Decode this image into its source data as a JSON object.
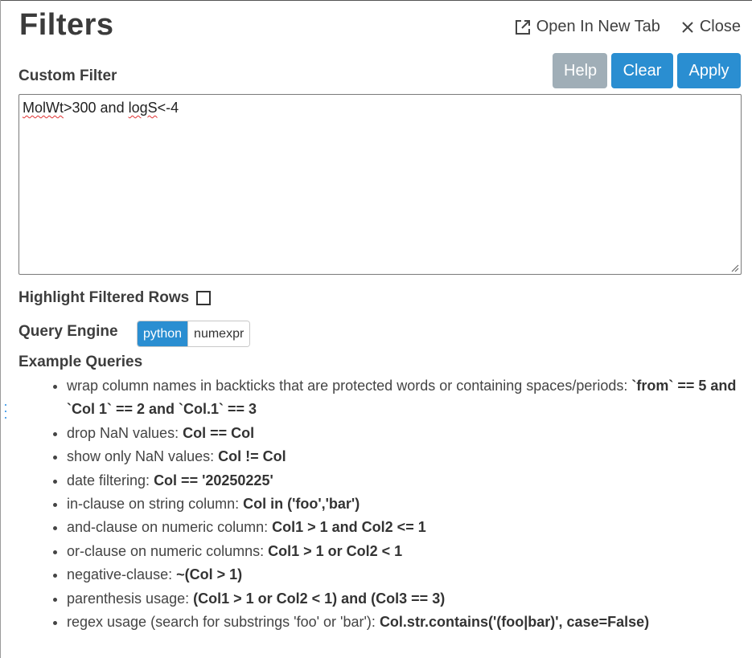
{
  "header": {
    "title": "Filters",
    "open_new_tab_label": "Open In New Tab",
    "close_label": "Close"
  },
  "custom_filter": {
    "label": "Custom Filter",
    "help_label": "Help",
    "clear_label": "Clear",
    "apply_label": "Apply",
    "query_part1": "MolWt",
    "query_part2": ">300 and ",
    "query_part3": "logS",
    "query_part4": "<-4"
  },
  "highlight": {
    "label": "Highlight Filtered Rows",
    "checked": false
  },
  "query_engine": {
    "label": "Query Engine",
    "options": [
      "python",
      "numexpr"
    ],
    "selected": "python"
  },
  "examples": {
    "title": "Example Queries",
    "items": [
      {
        "text": "wrap column names in backticks that are protected words or containing spaces/periods: ",
        "code": "`from` == 5 and `Col 1` == 2 and `Col.1` == 3"
      },
      {
        "text": "drop NaN values: ",
        "code": "Col == Col"
      },
      {
        "text": "show only NaN values: ",
        "code": "Col != Col"
      },
      {
        "text": "date filtering: ",
        "code": "Col == '20250225'"
      },
      {
        "text": "in-clause on string column: ",
        "code": "Col in ('foo','bar')"
      },
      {
        "text": "and-clause on numeric column: ",
        "code": "Col1 > 1 and Col2 <= 1"
      },
      {
        "text": "or-clause on numeric columns: ",
        "code": "Col1 > 1 or Col2 < 1"
      },
      {
        "text": "negative-clause: ",
        "code": "~(Col > 1)"
      },
      {
        "text": "parenthesis usage: ",
        "code": "(Col1 > 1 or Col2 < 1) and (Col3 == 3)"
      },
      {
        "text": "regex usage (search for substrings 'foo' or 'bar'): ",
        "code": "Col.str.contains('(foo|bar)', case=False)"
      }
    ]
  },
  "colors": {
    "primary_button": "#2a8ed1",
    "disabled_button": "#a0aeb7",
    "spellcheck_underline": "#e03131"
  },
  "icons": [
    "open-external-icon",
    "close-icon",
    "resize-grip-icon",
    "drag-handle-icon"
  ]
}
